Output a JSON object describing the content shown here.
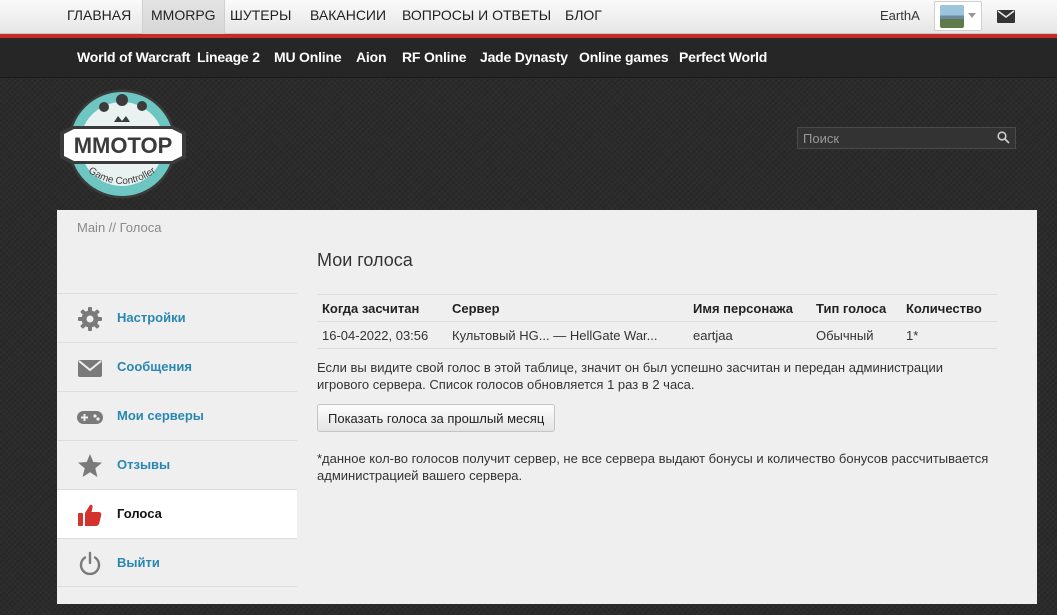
{
  "topnav": {
    "items": [
      "ГЛАВНАЯ",
      "MMORPG",
      "ШУТЕРЫ",
      "ВАКАНСИИ",
      "ВОПРОСЫ И ОТВЕТЫ",
      "БЛОГ"
    ],
    "active": "MMORPG",
    "username": "EarthA",
    "accent_color": "#c62a2a"
  },
  "gamesnav": {
    "items": [
      "World of Warcraft",
      "Lineage 2",
      "MU Online",
      "Aion",
      "RF Online",
      "Jade Dynasty",
      "Online games",
      "Perfect World"
    ]
  },
  "logo": {
    "text": "MMOTOP",
    "subtext": "Game Controller",
    "color": "#6ec6c2"
  },
  "search": {
    "placeholder": "Поиск",
    "icon": "search-icon"
  },
  "breadcrumb": "Main // Голоса",
  "sidebar": {
    "items": [
      {
        "label": "Настройки",
        "icon": "gear-icon"
      },
      {
        "label": "Сообщения",
        "icon": "envelope-icon"
      },
      {
        "label": "Мои серверы",
        "icon": "gamepad-icon"
      },
      {
        "label": "Отзывы",
        "icon": "star-icon"
      },
      {
        "label": "Голоса",
        "icon": "thumbs-up-icon",
        "active": true
      },
      {
        "label": "Выйти",
        "icon": "power-icon"
      }
    ]
  },
  "main": {
    "title": "Мои голоса",
    "table": {
      "headers": [
        "Когда засчитан",
        "Сервер",
        "Имя персонажа",
        "Тип голоса",
        "Количество"
      ],
      "rows": [
        [
          "16-04-2022, 03:56",
          "Культовый HG... — HellGate War...",
          "eartjaa",
          "Обычный",
          "1*"
        ]
      ]
    },
    "info": "Если вы видите свой голос в этой таблице, значит он был успешно засчитан и передан администрации игрового сервера. Список голосов обновляется 1 раз в 2 часа.",
    "button_label": "Показать голоса за прошлый месяц",
    "note": "*данное кол-во голосов получит сервер, не все сервера выдают бонусы и количество бонусов рассчитывается администрацией вашего сервера."
  }
}
